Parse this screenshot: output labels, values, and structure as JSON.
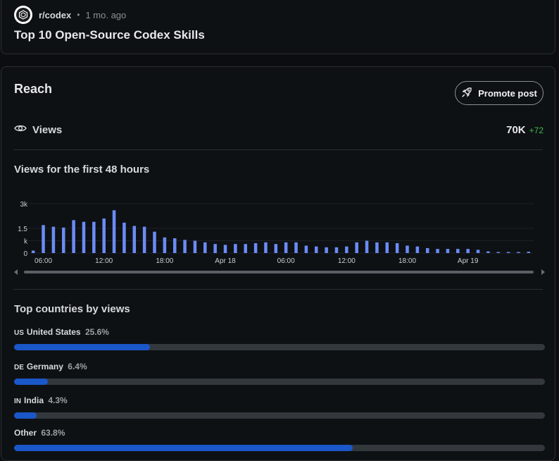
{
  "post": {
    "subreddit": "r/codex",
    "separator": "•",
    "age": "1 mo. ago",
    "title": "Top 10 Open-Source Codex Skills"
  },
  "reach": {
    "title": "Reach",
    "promote_label": "Promote post",
    "views_label": "Views",
    "views_total": "70K",
    "views_delta": "+72"
  },
  "chart": {
    "title": "Views for the first 48 hours"
  },
  "chart_data": {
    "type": "bar",
    "title": "Views for the first 48 hours",
    "color": "#6b8cf5",
    "ylim": [
      0,
      3000
    ],
    "y_ticks": [
      {
        "value": 3000,
        "label": "3k"
      },
      {
        "value": 1500,
        "label": "1.5"
      },
      {
        "value": 750,
        "label": "k"
      },
      {
        "value": 0,
        "label": "0"
      }
    ],
    "x_tick_labels": [
      {
        "index": 1,
        "label": "06:00"
      },
      {
        "index": 7,
        "label": "12:00"
      },
      {
        "index": 13,
        "label": "18:00"
      },
      {
        "index": 19,
        "label": "Apr 18"
      },
      {
        "index": 25,
        "label": "06:00"
      },
      {
        "index": 31,
        "label": "12:00"
      },
      {
        "index": 37,
        "label": "18:00"
      },
      {
        "index": 43,
        "label": "Apr 19"
      }
    ],
    "values": [
      150,
      1700,
      1600,
      1550,
      2000,
      1900,
      1900,
      2100,
      2600,
      1850,
      1650,
      1600,
      1300,
      950,
      900,
      800,
      750,
      650,
      550,
      500,
      550,
      550,
      600,
      650,
      550,
      650,
      650,
      450,
      400,
      350,
      350,
      400,
      650,
      750,
      650,
      650,
      600,
      450,
      400,
      300,
      250,
      250,
      250,
      250,
      200,
      100,
      50,
      50,
      60,
      80
    ]
  },
  "countries": {
    "title": "Top countries by views",
    "items": [
      {
        "code": "US",
        "name": "United States",
        "pct_label": "25.6%",
        "fraction": 0.256
      },
      {
        "code": "DE",
        "name": "Germany",
        "pct_label": "6.4%",
        "fraction": 0.064
      },
      {
        "code": "IN",
        "name": "India",
        "pct_label": "4.3%",
        "fraction": 0.043
      },
      {
        "code": "",
        "name": "Other",
        "pct_label": "63.8%",
        "fraction": 0.638
      }
    ]
  },
  "colors": {
    "background": "#0b0d10",
    "card": "#0e1114",
    "bar": "#6b8cf5",
    "progress_fill": "#1a57c9",
    "progress_track": "#33383d",
    "delta_positive": "#3fb950"
  },
  "icons": {
    "avatar": "codex-logo-icon",
    "promote": "rocket-icon",
    "views": "eye-icon"
  }
}
